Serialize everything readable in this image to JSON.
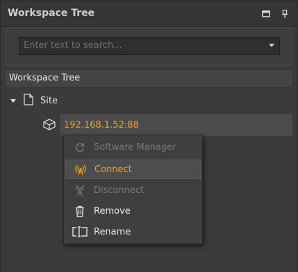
{
  "panel": {
    "title": "Workspace Tree",
    "buttons": [
      "maximize-icon",
      "pin-icon"
    ]
  },
  "search": {
    "placeholder": "Enter text to search..."
  },
  "section": {
    "header": "Workspace Tree"
  },
  "tree": {
    "root": {
      "label": "Site",
      "icon": "document-icon",
      "expanded": true
    },
    "device": {
      "label": "192.168.1.52:88",
      "icon": "device-box-icon",
      "color": "#f0a30a"
    }
  },
  "context_menu": {
    "items": [
      {
        "label": "Software Manager",
        "icon": "refresh-icon",
        "state": "disabled"
      },
      {
        "label": "Connect",
        "icon": "antenna-icon",
        "state": "active"
      },
      {
        "label": "Disconnect",
        "icon": "tower-icon",
        "state": "disabled"
      },
      {
        "label": "Remove",
        "icon": "trash-icon",
        "state": "normal"
      },
      {
        "label": "Rename",
        "icon": "rename-icon",
        "state": "normal"
      }
    ]
  },
  "colors": {
    "accent": "#f0a30a",
    "background": "#3a3a3a",
    "disabled_text": "#777777"
  }
}
